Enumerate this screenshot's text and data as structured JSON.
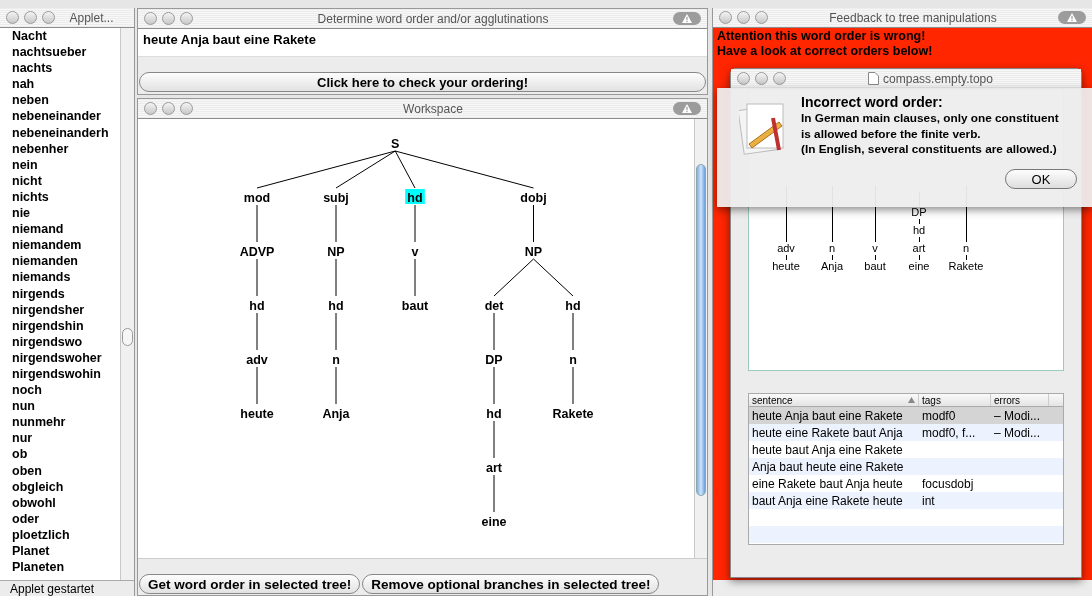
{
  "applet_window": {
    "title": "Applet...",
    "words": [
      "Nacht",
      "nachtsueber",
      "nachts",
      "nah",
      "neben",
      "nebeneinander",
      "nebeneinanderh",
      "nebenher",
      "nein",
      "nicht",
      "nichts",
      "nie",
      "niemand",
      "niemandem",
      "niemanden",
      "niemands",
      "nirgends",
      "nirgendsher",
      "nirgendshin",
      "nirgendswo",
      "nirgendswoher",
      "nirgendswohin",
      "noch",
      "nun",
      "nunmehr",
      "nur",
      "ob",
      "oben",
      "obgleich",
      "obwohl",
      "oder",
      "ploetzlich",
      "Planet",
      "Planeten"
    ],
    "status": "Applet gestartet"
  },
  "order_window": {
    "title": "Determine word order and/or agglutinations",
    "sentence": "heute Anja baut eine Rakete",
    "check_button": "Click here to check your ordering!"
  },
  "workspace": {
    "title": "Workspace",
    "tree": {
      "label": "S",
      "selected": false,
      "children": [
        {
          "label": "mod",
          "selected": false,
          "children": [
            {
              "label": "ADVP",
              "selected": false,
              "children": [
                {
                  "label": "hd",
                  "selected": false,
                  "children": [
                    {
                      "label": "adv",
                      "selected": false,
                      "children": [
                        {
                          "label": "heute",
                          "selected": false
                        }
                      ]
                    }
                  ]
                }
              ]
            }
          ]
        },
        {
          "label": "subj",
          "selected": false,
          "children": [
            {
              "label": "NP",
              "selected": false,
              "children": [
                {
                  "label": "hd",
                  "selected": false,
                  "children": [
                    {
                      "label": "n",
                      "selected": false,
                      "children": [
                        {
                          "label": "Anja",
                          "selected": false
                        }
                      ]
                    }
                  ]
                }
              ]
            }
          ]
        },
        {
          "label": "hd",
          "selected": true,
          "children": [
            {
              "label": "v",
              "selected": false,
              "children": [
                {
                  "label": "baut",
                  "selected": false
                }
              ]
            }
          ]
        },
        {
          "label": "dobj",
          "selected": false,
          "children": [
            {
              "label": "NP",
              "selected": false,
              "children": [
                {
                  "label": "det",
                  "selected": false,
                  "children": [
                    {
                      "label": "DP",
                      "selected": false,
                      "children": [
                        {
                          "label": "hd",
                          "selected": false,
                          "children": [
                            {
                              "label": "art",
                              "selected": false,
                              "children": [
                                {
                                  "label": "eine",
                                  "selected": false
                                }
                              ]
                            }
                          ]
                        }
                      ]
                    }
                  ]
                },
                {
                  "label": "hd",
                  "selected": false,
                  "children": [
                    {
                      "label": "n",
                      "selected": false,
                      "children": [
                        {
                          "label": "Rakete",
                          "selected": false
                        }
                      ]
                    }
                  ]
                }
              ]
            }
          ]
        }
      ]
    },
    "buttons": [
      "Get word order in selected tree!",
      "Remove optional branches in selected tree!"
    ]
  },
  "feedback_window": {
    "title": "Feedback to tree manipulations",
    "messages": [
      "Attention this word order is wrong!",
      "Have a look at correct orders below!"
    ],
    "inner_window": {
      "title": "compass.empty.topo",
      "preview_columns": [
        {
          "labels": [
            "adv",
            "heute"
          ]
        },
        {
          "labels": [
            "n",
            "Anja"
          ]
        },
        {
          "labels": [
            "v",
            "baut"
          ]
        },
        {
          "labels": [
            "DP",
            "hd",
            "art",
            "eine"
          ]
        },
        {
          "labels": [
            "n",
            "Rakete"
          ]
        }
      ],
      "table": {
        "columns": [
          "sentence",
          "tags",
          "errors"
        ],
        "rows": [
          {
            "cells": [
              "heute Anja baut eine Rakete",
              "modf0",
              "– Modi..."
            ],
            "selected": true
          },
          {
            "cells": [
              "heute eine Rakete baut Anja",
              "modf0, f...",
              "– Modi..."
            ],
            "selected": false
          },
          {
            "cells": [
              "heute baut Anja eine Rakete",
              "",
              ""
            ],
            "selected": false
          },
          {
            "cells": [
              "Anja baut heute eine Rakete",
              "",
              ""
            ],
            "selected": false
          },
          {
            "cells": [
              "eine Rakete baut Anja heute",
              "focusdobj",
              ""
            ],
            "selected": false
          },
          {
            "cells": [
              "baut Anja eine Rakete heute",
              "int",
              ""
            ],
            "selected": false
          }
        ]
      }
    },
    "alert": {
      "title": "Incorrect word order:",
      "lines": [
        "In German main clauses, only one constituent",
        "is allowed before the finite verb.",
        "(In English, several constituents are allowed.)"
      ],
      "ok_button": "OK"
    }
  }
}
